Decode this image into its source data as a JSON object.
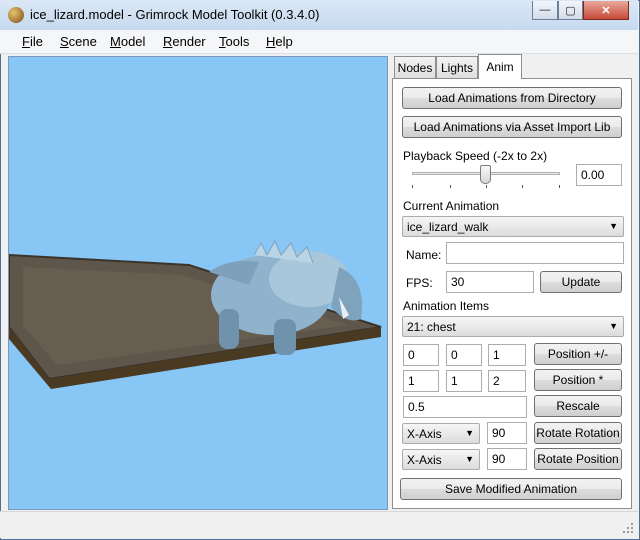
{
  "window": {
    "title": "ice_lizard.model - Grimrock Model Toolkit (0.3.4.0)",
    "controls": {
      "minimize": "—",
      "maximize": "▢",
      "close": "✕"
    }
  },
  "menu": [
    {
      "key": "F",
      "rest": "ile"
    },
    {
      "key": "S",
      "rest": "cene"
    },
    {
      "key": "M",
      "rest": "odel"
    },
    {
      "key": "R",
      "rest": "ender"
    },
    {
      "key": "T",
      "rest": "ools"
    },
    {
      "key": "H",
      "rest": "elp"
    }
  ],
  "tabs": [
    "Nodes",
    "Lights",
    "Anim"
  ],
  "anim": {
    "load_dir_label": "Load Animations from Directory",
    "load_asset_label": "Load Animations via Asset Import Lib",
    "playback_label": "Playback Speed (-2x to 2x)",
    "playback_value": "0.00",
    "current_label": "Current Animation",
    "current_value": "ice_lizard_walk",
    "name_label": "Name:",
    "name_value": "",
    "fps_label": "FPS:",
    "fps_value": "30",
    "update_label": "Update",
    "items_label": "Animation Items",
    "items_value": "21: chest",
    "pos_row": {
      "a": "0",
      "b": "0",
      "c": "1",
      "button": "Position +/-"
    },
    "scale_row": {
      "a": "1",
      "b": "1",
      "c": "2",
      "button": "Position *"
    },
    "rescale_value": "0.5",
    "rescale_button": "Rescale",
    "rot_row": {
      "axis": "X-Axis",
      "value": "90",
      "button": "Rotate Rotation"
    },
    "rotpos_row": {
      "axis": "X-Axis",
      "value": "90",
      "button": "Rotate Position"
    },
    "save_label": "Save Modified Animation"
  },
  "colors": {
    "viewport_bg": "#87c6f5",
    "floor": "#5b5347",
    "lizard": "#8fb3cc"
  }
}
